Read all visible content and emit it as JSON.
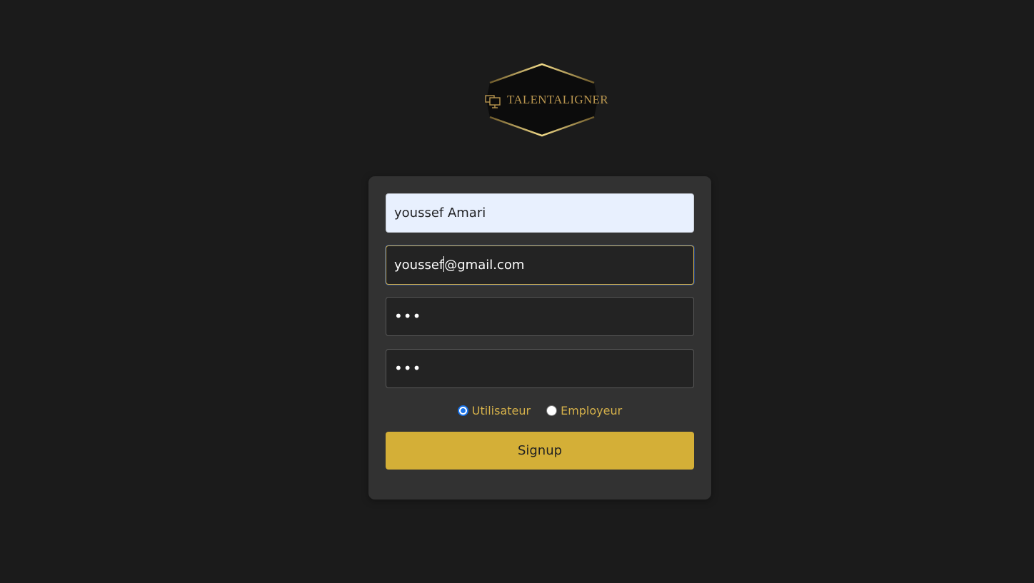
{
  "logo": {
    "text": "TALENTALIGNER",
    "accent_color": "#d4af37",
    "icon": "monitors-icon"
  },
  "form": {
    "name_value": "youssef Amari",
    "email_value_before_caret": "youssef",
    "email_value_after_caret": "@gmail.com",
    "password_mask": "•••",
    "confirm_password_mask": "•••",
    "roles": [
      {
        "label": "Utilisateur",
        "checked": true
      },
      {
        "label": "Employeur",
        "checked": false
      }
    ],
    "submit_label": "Signup"
  },
  "colors": {
    "background": "#1b1b1b",
    "card": "#323232",
    "button": "#d4af37",
    "role_label": "#d4b04a"
  }
}
